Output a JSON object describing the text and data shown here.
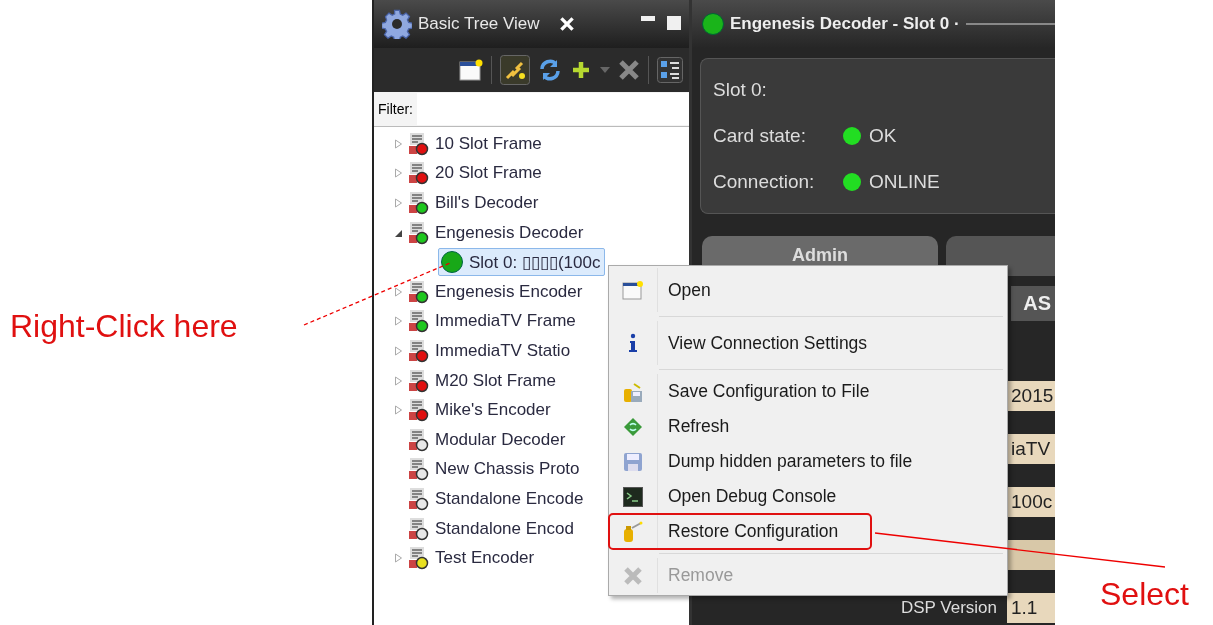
{
  "annotations": {
    "right_click": "Right-Click here",
    "select": "Select"
  },
  "tree_view": {
    "title": "Basic Tree View",
    "filter_label": "Filter:",
    "items": [
      {
        "label": "10 Slot Frame",
        "color": "#e01010",
        "expandable": true,
        "expanded": false
      },
      {
        "label": "20 Slot Frame",
        "color": "#e01010",
        "expandable": true,
        "expanded": false
      },
      {
        "label": "Bill's Decoder",
        "color": "#1ec81e",
        "expandable": true,
        "expanded": false
      },
      {
        "label": "Engenesis Decoder",
        "color": "#1ec81e",
        "expandable": true,
        "expanded": true,
        "children": [
          {
            "label": "Slot 0: ▯▯▯▯(100c",
            "color": "#18a818",
            "selected": true
          }
        ]
      },
      {
        "label": "Engenesis Encoder",
        "color": "#1ec81e",
        "expandable": true,
        "expanded": false
      },
      {
        "label": "ImmediaTV Frame",
        "color": "#1ec81e",
        "expandable": true,
        "expanded": false
      },
      {
        "label": "ImmediaTV Statio",
        "color": "#e01010",
        "expandable": true,
        "expanded": false
      },
      {
        "label": "M20 Slot Frame",
        "color": "#e01010",
        "expandable": true,
        "expanded": false
      },
      {
        "label": "Mike's Encoder",
        "color": "#e01010",
        "expandable": true,
        "expanded": false
      },
      {
        "label": "Modular Decoder",
        "color": "#e8e8e8",
        "expandable": false
      },
      {
        "label": "New Chassis Proto",
        "color": "#e8e8e8",
        "expandable": false
      },
      {
        "label": "Standalone Encode",
        "color": "#e8e8e8",
        "expandable": false
      },
      {
        "label": "Standalone Encod",
        "color": "#e8e8e8",
        "expandable": false
      },
      {
        "label": "Test Encoder",
        "color": "#e8e020",
        "expandable": true,
        "expanded": false
      }
    ]
  },
  "device_panel": {
    "title": "Engenesis Decoder - Slot 0 ·",
    "slot": "Slot 0:",
    "status": [
      {
        "label": "Card state:",
        "value": "OK",
        "color": "#22dd22"
      },
      {
        "label": "Connection:",
        "value": "ONLINE",
        "color": "#22dd22"
      }
    ],
    "tabs": [
      {
        "label": "Admin",
        "selected": true
      },
      {
        "selected": false
      }
    ],
    "subtab": "AS",
    "fields": [
      {
        "kind": "value",
        "value": "2015"
      },
      {
        "kind": "value",
        "value": "iaTV"
      },
      {
        "kind": "value",
        "value": "100c"
      },
      {
        "kind": "blank"
      },
      {
        "kind": "value",
        "label": "DSP Version",
        "value": "1.1"
      }
    ]
  },
  "context_menu": [
    {
      "kind": "open",
      "label": "Open",
      "disabled": false,
      "outlined": false,
      "separator_after": true
    },
    {
      "kind": "info",
      "label": "View Connection Settings",
      "disabled": false,
      "outlined": false,
      "separator_after": true
    },
    {
      "kind": "save",
      "label": "Save Configuration to File",
      "disabled": false,
      "outlined": false,
      "separator_after": false
    },
    {
      "kind": "refresh",
      "label": "Refresh",
      "disabled": false,
      "outlined": false,
      "separator_after": false
    },
    {
      "kind": "dump",
      "label": "Dump hidden parameters to file",
      "disabled": false,
      "outlined": false,
      "separator_after": false
    },
    {
      "kind": "console",
      "label": "Open Debug Console",
      "disabled": false,
      "outlined": false,
      "separator_after": false
    },
    {
      "kind": "restore",
      "label": "Restore Configuration",
      "disabled": false,
      "outlined": true,
      "separator_after": true
    },
    {
      "kind": "remove",
      "label": "Remove",
      "disabled": true,
      "outlined": false,
      "separator_after": false
    }
  ]
}
